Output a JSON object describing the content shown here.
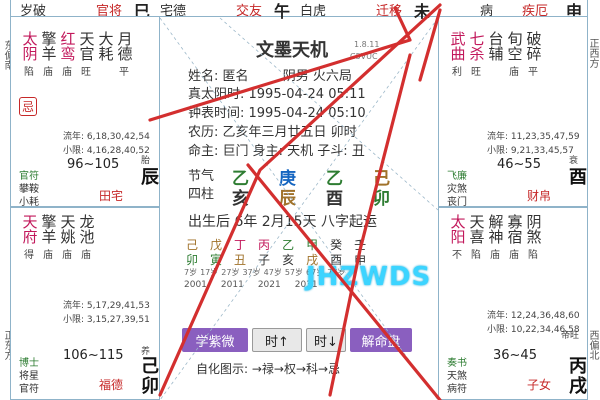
{
  "side_labels": {
    "left_top": "东偏南",
    "left_bottom": "正东方",
    "right_top": "正西方",
    "right_bottom": "西偏北"
  },
  "top_strip": {
    "t1": "岁破",
    "t2": "官将",
    "t3": "巳",
    "t4": "宅德",
    "t5": "交友",
    "t6": "午",
    "t7": "白虎",
    "t8": "迁移",
    "t9": "未",
    "t10": "病",
    "t11": "疾厄",
    "t12": "申"
  },
  "cells": {
    "tl": {
      "stars": [
        {
          "s": "太阴",
          "l": "陷"
        },
        {
          "s": "擎羊",
          "l": "庙"
        },
        {
          "s": "红鸾",
          "l": "庙"
        },
        {
          "s": "天官",
          "l": "旺"
        },
        {
          "s": "大耗",
          "l": ""
        },
        {
          "s": "月德",
          "l": "平"
        }
      ],
      "ji": "忌",
      "liunian": "流年: 6,18,30,42,54",
      "xiaoxian": "小限: 4,16,28,40,52",
      "god1": "官符",
      "god2": "攀鞍",
      "god3": "小耗",
      "age": "96~105",
      "stage": "胎",
      "palace": "田宅",
      "ganzhi": "庚辰"
    },
    "tr": {
      "stars": [
        {
          "s": "武曲",
          "l": "利"
        },
        {
          "s": "七杀",
          "l": "旺"
        },
        {
          "s": "台辅",
          "l": ""
        },
        {
          "s": "旬空",
          "l": "庙"
        },
        {
          "s": "破碎",
          "l": "平"
        }
      ],
      "liunian": "流年: 11,23,35,47,59",
      "xiaoxian": "小限: 9,21,33,45,57",
      "god1": "飞廉",
      "god2": "灾煞",
      "god3": "丧门",
      "age": "46~55",
      "stage": "衰",
      "palace": "财帛",
      "ganzhi": "乙酉"
    },
    "bl": {
      "stars": [
        {
          "s": "天府",
          "l": "得"
        },
        {
          "s": "擎羊",
          "l": "庙"
        },
        {
          "s": "天姚",
          "l": "庙"
        },
        {
          "s": "龙池",
          "l": "庙"
        }
      ],
      "liunian": "流年: 5,17,29,41,53",
      "xiaoxian": "小限: 3,15,27,39,51",
      "god1": "博士",
      "god2": "将星",
      "god3": "官符",
      "age": "106~115",
      "stage": "养",
      "palace": "福德",
      "ganzhi": "己卯"
    },
    "br": {
      "stars": [
        {
          "s": "太阳",
          "l": "不"
        },
        {
          "s": "天喜",
          "l": "陷"
        },
        {
          "s": "解神",
          "l": "庙"
        },
        {
          "s": "寡宿",
          "l": "庙"
        },
        {
          "s": "阴煞",
          "l": "陷"
        }
      ],
      "liunian": "流年: 12,24,36,48,60",
      "xiaoxian": "小限: 10,22,34,46,58",
      "god1": "奏书",
      "god2": "天煞",
      "god3": "病符",
      "age": "36~45",
      "stage": "帝旺",
      "palace": "子女",
      "ganzhi": "丙戌"
    }
  },
  "center": {
    "title": "文墨天机",
    "version": "1.8.11",
    "code": "C5VUC",
    "name_label": "姓名:",
    "name_value": "匿名",
    "gender": "阴男 火六局",
    "true_solar": "真太阳时: 1995-04-24 05:11",
    "clock_time": "钟表时间: 1995-04-24 05:10",
    "lunar": "农历: 乙亥年三月廿五日 卯时",
    "ming_zhu": "命主: 巨门 身主: 天机 子斗: 丑",
    "pillar_label1": "节气",
    "pillar_label2": "四柱",
    "pillars_top": [
      "乙",
      "庚",
      "乙",
      "己"
    ],
    "pillars_bottom": [
      "亥",
      "辰",
      "酉",
      "卯"
    ],
    "birth_line": "出生后 6年 2月15天 八字起运",
    "dayun_top": [
      "己",
      "戊",
      "丁",
      "丙",
      "乙",
      "甲",
      "癸",
      "壬"
    ],
    "dayun_bottom": [
      "卯",
      "寅",
      "丑",
      "子",
      "亥",
      "戌",
      "酉",
      "申"
    ],
    "dayun_ages": [
      "7岁",
      "17岁",
      "27岁",
      "37岁",
      "47岁",
      "57岁",
      "67岁",
      "77岁"
    ],
    "dayun_years": [
      "2001",
      "2011",
      "2021",
      "2031"
    ],
    "btn_xueziwei": "学紫微",
    "btn_prev": "时↑",
    "btn_next": "时↓",
    "btn_jieming": "解命盘",
    "legend": "自化图示: →禄→权→科→忌"
  },
  "watermark": "JHZWDS",
  "colors": {
    "lu": "#2e7d32",
    "quan": "#1565c0",
    "ke": "#2e7d32",
    "ji": "#c62828",
    "button": "#8a5fbf",
    "ink_red": "#d32f2f"
  }
}
